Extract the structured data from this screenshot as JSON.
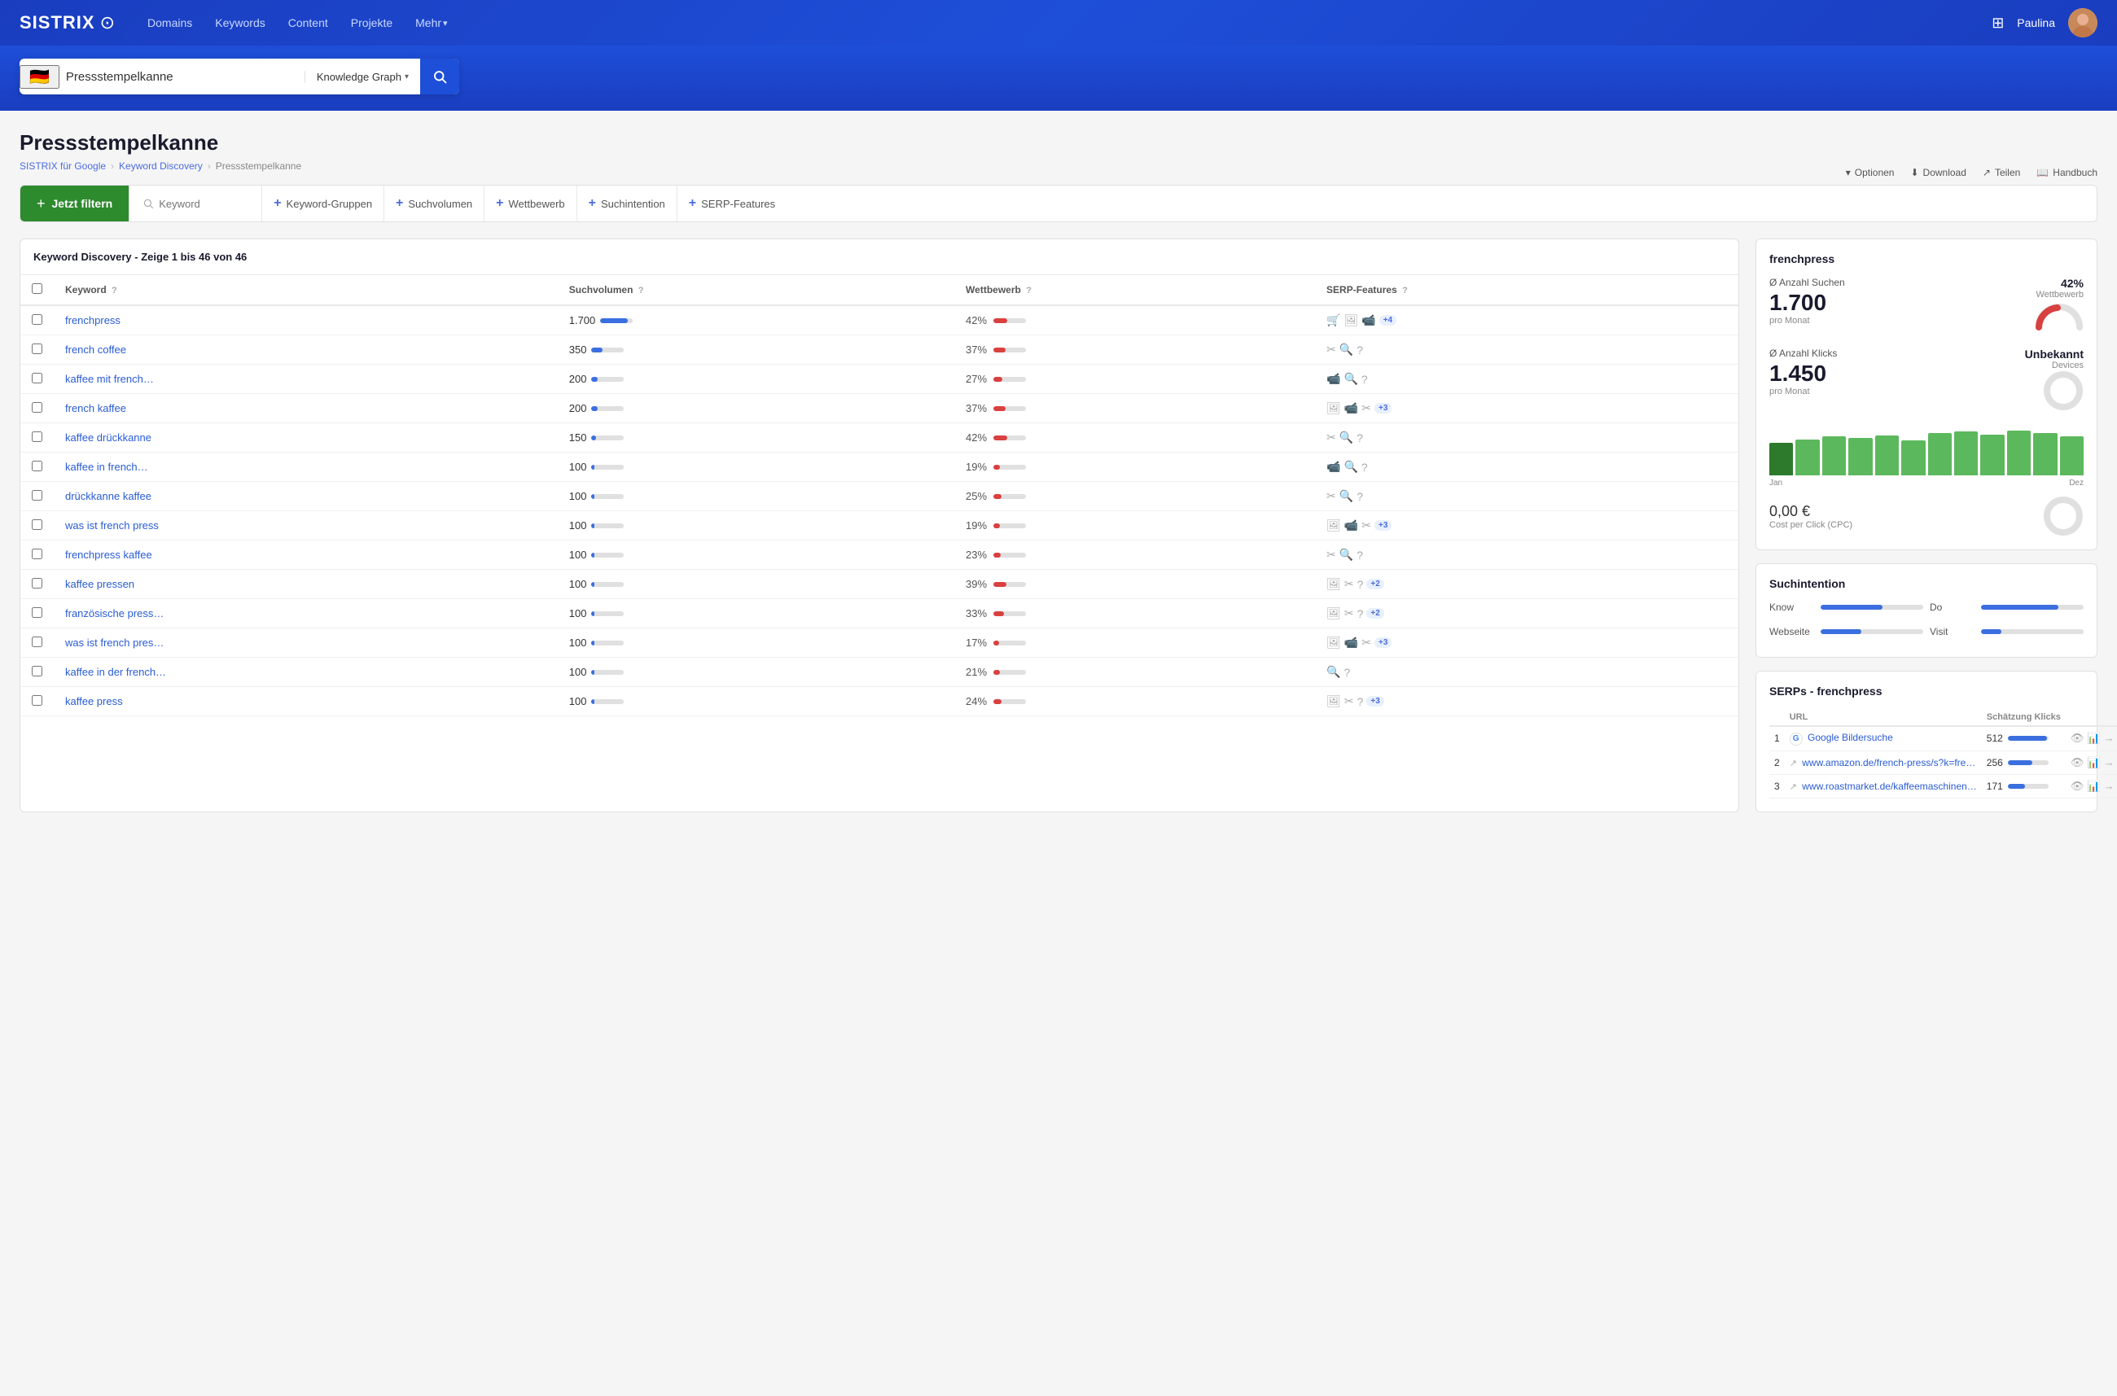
{
  "nav": {
    "logo": "SISTRIX",
    "links": [
      "Domains",
      "Keywords",
      "Content",
      "Projekte",
      "Mehr"
    ],
    "user": "Paulina"
  },
  "search": {
    "flag": "🇩🇪",
    "query": "Pressstempelkanne",
    "type": "Knowledge Graph",
    "placeholder": "Pressstempelkanne"
  },
  "page": {
    "title": "Pressstempelkanne",
    "breadcrumb": [
      "SISTRIX für Google",
      "Keyword Discovery",
      "Pressstempelkanne"
    ],
    "actions": [
      "Optionen",
      "Download",
      "Teilen",
      "Handbuch"
    ]
  },
  "filter": {
    "btn_label": "Jetzt filtern",
    "search_placeholder": "Keyword",
    "groups": [
      "Keyword-Gruppen",
      "Suchvolumen",
      "Wettbewerb",
      "Suchintention",
      "SERP-Features"
    ]
  },
  "table": {
    "title": "Keyword Discovery - Zeige 1 bis 46 von 46",
    "cols": [
      "Keyword",
      "Suchvolumen",
      "Wettbewerb",
      "SERP-Features"
    ],
    "rows": [
      {
        "keyword": "frenchpress",
        "vol": "1.700",
        "vol_pct": 85,
        "comp": "42%",
        "comp_pct": 42,
        "serp": [
          "🛒",
          "🖼",
          "📹"
        ],
        "extra": "+4"
      },
      {
        "keyword": "french coffee",
        "vol": "350",
        "vol_pct": 35,
        "comp": "37%",
        "comp_pct": 37,
        "serp": [
          "✂",
          "🔍",
          "?"
        ],
        "extra": ""
      },
      {
        "keyword": "kaffee mit french…",
        "vol": "200",
        "vol_pct": 20,
        "comp": "27%",
        "comp_pct": 27,
        "serp": [
          "📹",
          "🔍",
          "?"
        ],
        "extra": ""
      },
      {
        "keyword": "french kaffee",
        "vol": "200",
        "vol_pct": 20,
        "comp": "37%",
        "comp_pct": 37,
        "serp": [
          "🖼",
          "📹",
          "✂"
        ],
        "extra": "+3"
      },
      {
        "keyword": "kaffee drückkanne",
        "vol": "150",
        "vol_pct": 15,
        "comp": "42%",
        "comp_pct": 42,
        "serp": [
          "✂",
          "🔍",
          "?"
        ],
        "extra": ""
      },
      {
        "keyword": "kaffee in french…",
        "vol": "100",
        "vol_pct": 10,
        "comp": "19%",
        "comp_pct": 19,
        "serp": [
          "📹",
          "🔍",
          "?"
        ],
        "extra": ""
      },
      {
        "keyword": "drückkanne kaffee",
        "vol": "100",
        "vol_pct": 10,
        "comp": "25%",
        "comp_pct": 25,
        "serp": [
          "✂",
          "🔍",
          "?"
        ],
        "extra": ""
      },
      {
        "keyword": "was ist french press",
        "vol": "100",
        "vol_pct": 10,
        "comp": "19%",
        "comp_pct": 19,
        "serp": [
          "🖼",
          "📹",
          "✂"
        ],
        "extra": "+3"
      },
      {
        "keyword": "frenchpress kaffee",
        "vol": "100",
        "vol_pct": 10,
        "comp": "23%",
        "comp_pct": 23,
        "serp": [
          "✂",
          "🔍",
          "?"
        ],
        "extra": ""
      },
      {
        "keyword": "kaffee pressen",
        "vol": "100",
        "vol_pct": 10,
        "comp": "39%",
        "comp_pct": 39,
        "serp": [
          "🖼",
          "✂",
          "?"
        ],
        "extra": "+2"
      },
      {
        "keyword": "französische press…",
        "vol": "100",
        "vol_pct": 10,
        "comp": "33%",
        "comp_pct": 33,
        "serp": [
          "🖼",
          "✂",
          "?"
        ],
        "extra": "+2"
      },
      {
        "keyword": "was ist french pres…",
        "vol": "100",
        "vol_pct": 10,
        "comp": "17%",
        "comp_pct": 17,
        "serp": [
          "🖼",
          "📹",
          "✂"
        ],
        "extra": "+3"
      },
      {
        "keyword": "kaffee in der french…",
        "vol": "100",
        "vol_pct": 10,
        "comp": "21%",
        "comp_pct": 21,
        "serp": [
          "🔍",
          "?"
        ],
        "extra": ""
      },
      {
        "keyword": "kaffee press",
        "vol": "100",
        "vol_pct": 10,
        "comp": "24%",
        "comp_pct": 24,
        "serp": [
          "🖼",
          "✂",
          "?"
        ],
        "extra": "+3"
      }
    ]
  },
  "side": {
    "keyword": "frenchpress",
    "avg_searches_label": "Ø Anzahl Suchen",
    "avg_searches_value": "1.700",
    "avg_searches_sub": "pro Monat",
    "avg_clicks_label": "Ø Anzahl Klicks",
    "avg_clicks_value": "1.450",
    "avg_clicks_sub": "pro Monat",
    "competition_pct": "42%",
    "competition_label": "Wettbewerb",
    "devices_label": "Unbekannt",
    "devices_sub": "Devices",
    "cpc": "0,00 €",
    "cpc_label": "Cost per Click (CPC)",
    "chart_bars": [
      65,
      72,
      78,
      75,
      80,
      70,
      85,
      88,
      82,
      90,
      85,
      78
    ],
    "chart_label_start": "Jan",
    "chart_label_end": "Dez",
    "intent_title": "Suchintention",
    "intents": [
      {
        "label": "Know",
        "pct": 60
      },
      {
        "label": "Do",
        "pct": 75
      },
      {
        "label": "Webseite",
        "pct": 40
      },
      {
        "label": "Visit",
        "pct": 20
      }
    ],
    "serps_title": "SERPs - frenchpress",
    "serps_col1": "URL",
    "serps_col2": "Schätzung Klicks",
    "serps": [
      {
        "num": 1,
        "icon": "google",
        "url": "Google Bildersuche",
        "clicks": 512,
        "bar_pct": 80
      },
      {
        "num": 2,
        "icon": "ext",
        "url": "www.amazon.de/french-press/s?k=fre…",
        "clicks": 256,
        "bar_pct": 50
      },
      {
        "num": 3,
        "icon": "ext",
        "url": "www.roastmarket.de/kaffeemaschinen…",
        "clicks": 171,
        "bar_pct": 35
      }
    ]
  }
}
